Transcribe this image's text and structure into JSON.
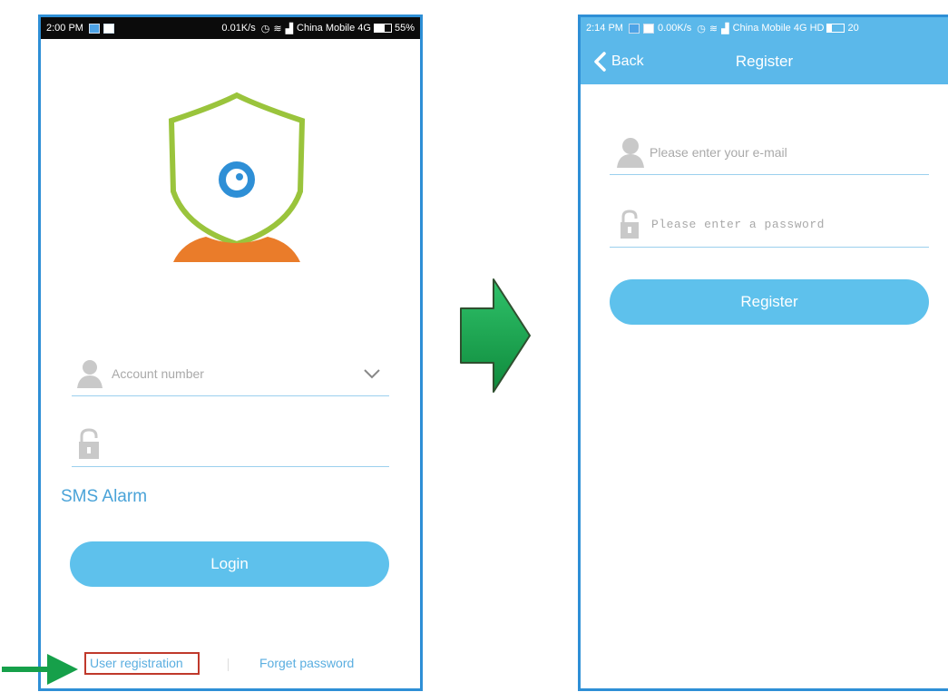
{
  "login_screen": {
    "status_bar": {
      "time": "2:00 PM",
      "network_speed": "0.01K/s",
      "carrier": "China Mobile 4G",
      "battery": "55%"
    },
    "account_placeholder": "Account number",
    "sms_alarm_label": "SMS Alarm",
    "login_button": "Login",
    "user_registration_link": "User registration",
    "forget_password_link": "Forget password"
  },
  "register_screen": {
    "status_bar": {
      "time": "2:14 PM",
      "network_speed": "0.00K/s",
      "carrier": "China Mobile 4G HD",
      "battery": "20"
    },
    "back_label": "Back",
    "title": "Register",
    "email_placeholder": "Please enter your e-mail",
    "password_placeholder": "Please enter a password",
    "register_button": "Register"
  },
  "colors": {
    "accent_blue": "#5ec1ec",
    "frame_blue": "#2e8fd6",
    "logo_green": "#9ac43c",
    "logo_orange": "#ea7c2a",
    "arrow_green": "#16a04a",
    "highlight_red": "#c0392b"
  }
}
